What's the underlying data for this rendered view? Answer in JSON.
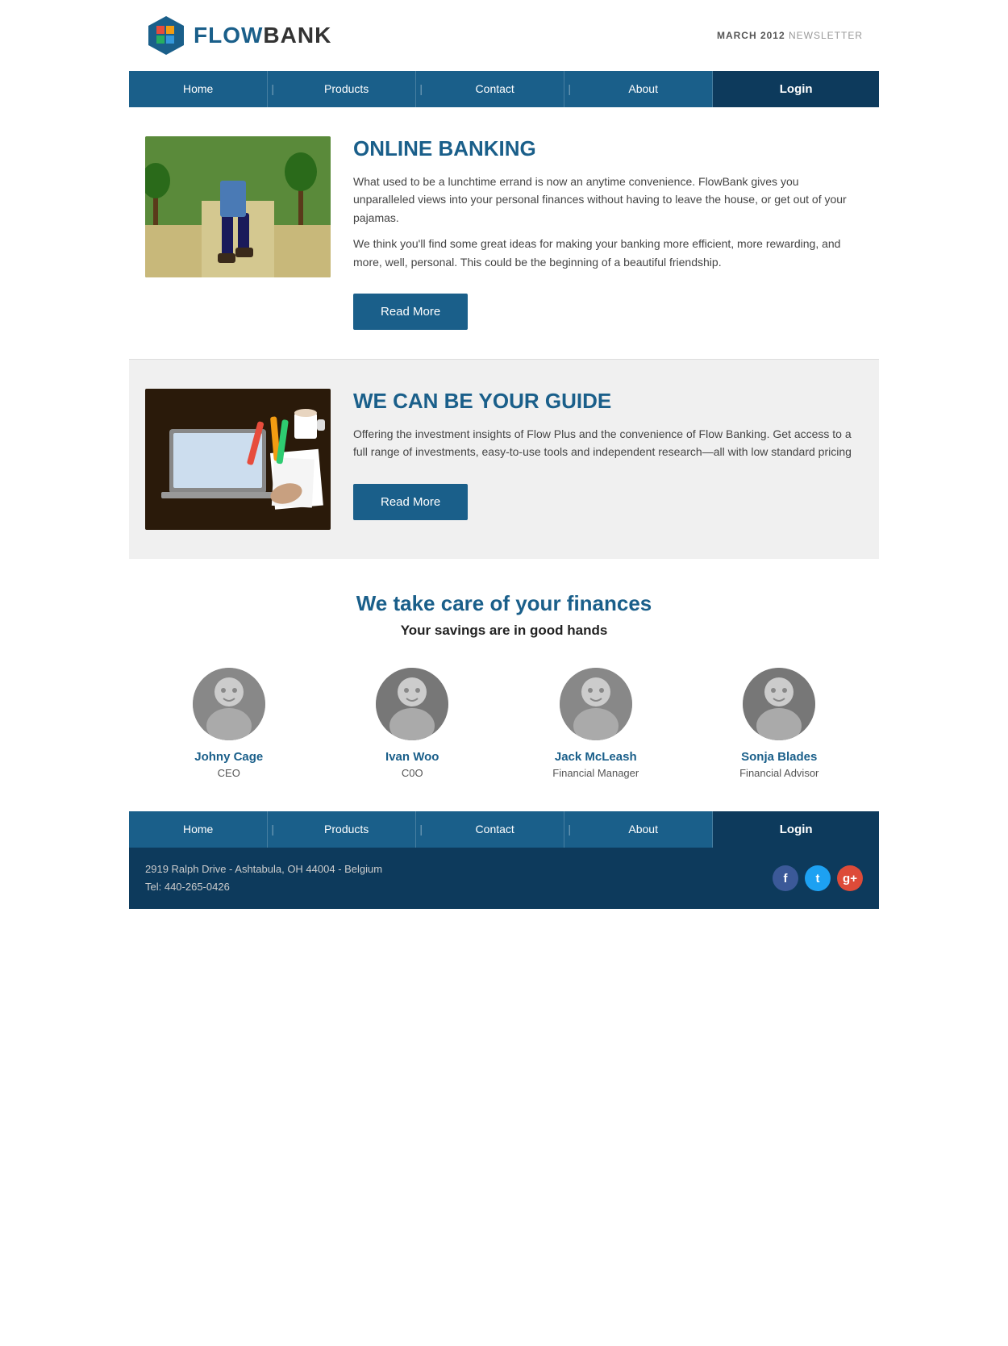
{
  "header": {
    "logo_flow": "FLOW",
    "logo_bank": "BANK",
    "newsletter": "MARCH 2012",
    "newsletter_suffix": " NEWSLETTER"
  },
  "nav": {
    "items": [
      "Home",
      "Products",
      "Contact",
      "About"
    ],
    "login": "Login"
  },
  "section1": {
    "title": "ONLINE BANKING",
    "body1": "What used to be a lunchtime errand is now an anytime convenience. FlowBank gives you unparalleled views into your personal finances without having to leave the house, or get out of your pajamas.",
    "body2": "We think you'll find some great ideas for making your banking more efficient, more rewarding, and more, well, personal. This could be the beginning of a beautiful friendship.",
    "button": "Read More"
  },
  "section2": {
    "title": "WE CAN BE YOUR GUIDE",
    "body": "Offering the investment insights of Flow Plus and the convenience of Flow Banking. Get access to a full range of investments, easy-to-use tools and independent research—all with low standard pricing",
    "button": "Read More"
  },
  "team": {
    "title": "We take care of your finances",
    "subtitle": "Your savings are in good hands",
    "members": [
      {
        "name": "Johny Cage",
        "role": "CEO"
      },
      {
        "name": "Ivan Woo",
        "role": "C0O"
      },
      {
        "name": "Jack McLeash",
        "role": "Financial Manager"
      },
      {
        "name": "Sonja Blades",
        "role": "Financial Advisor"
      }
    ]
  },
  "footer": {
    "address": "2919 Ralph Drive - Ashtabula, OH 44004 - Belgium",
    "tel": "Tel: 440-265-0426"
  }
}
